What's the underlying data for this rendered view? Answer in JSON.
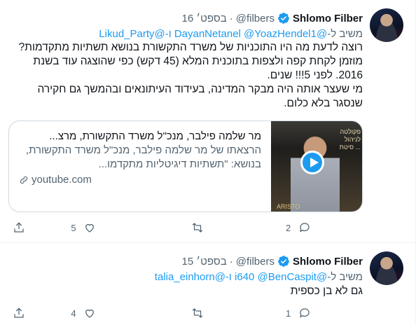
{
  "tweets": [
    {
      "name": "Shlomo Filber",
      "handle": "@filbers",
      "dot": "·",
      "time": "16 בספט׳",
      "reply_prefix": "משיב ל-",
      "reply_links": "@DayanNetanel @YoazHendel1 ו-@Likud_Party",
      "body_lines": [
        "רוצה לדעת מה היו התוכניות של משרד התקשורת בנושא תשתיות מתקדמות? מוזמן לקחת קפה ולצפות בתוכנית המלא (45 דקש) כפי שהוצגה עוד בשנת 2016. לפני 5!!! שנים.",
        "מי שעצר אותה היה מבקר המדינה, בעידוד העיתונאים ובהמשך גם חקירה שנסגר בלא כלום."
      ],
      "card": {
        "title": "מר שלמה פילבר, מנכ\"ל משרד התקשורת, מרצ...",
        "description": "הרצאתו של מר שלמה פילבר, מנכ\"ל משרד התקשורת, בנושא: \"תשתיות דיגיטליות מתקדמו...",
        "domain": "youtube.com",
        "thumb_banner": "פקולטה לניהול ... סיטת תל-א",
        "thumb_logo": "ARISTO"
      },
      "actions": {
        "reply_count": "2",
        "retweet_count": "",
        "like_count": "5"
      }
    },
    {
      "name": "Shlomo Filber",
      "handle": "@filbers",
      "dot": "·",
      "time": "15 בספט׳",
      "reply_prefix": "משיב ל-",
      "reply_links": "@i640 @BenCaspit ו-@talia_einhorn",
      "body_lines": [
        "גם לא בן כספית"
      ],
      "actions": {
        "reply_count": "1",
        "retweet_count": "",
        "like_count": "4"
      }
    }
  ],
  "colors": {
    "accent": "#1d9bf0",
    "muted": "#536471",
    "text": "#0f1419"
  },
  "icons": [
    "verified-badge-icon",
    "reply-icon",
    "retweet-icon",
    "like-icon",
    "share-icon",
    "link-icon",
    "play-icon"
  ]
}
